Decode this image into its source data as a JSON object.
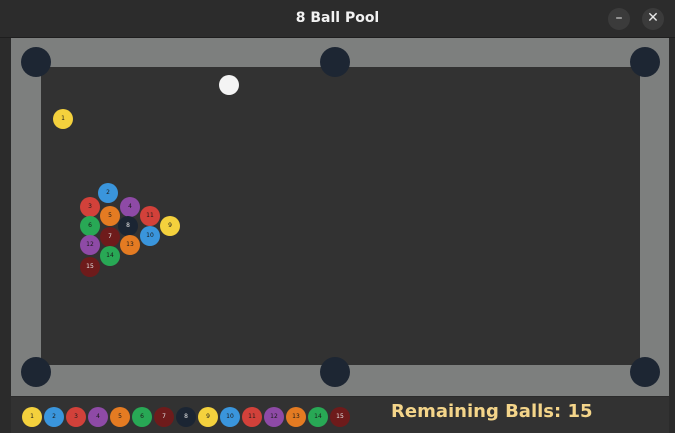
{
  "window": {
    "title": "8 Ball Pool",
    "minimize_label": "–",
    "close_label": "✕"
  },
  "colors": {
    "felt": "#323232",
    "rail": "#7d7f7e",
    "pocket": "#1d2633",
    "cue_ball": "#f4f4f4",
    "score_text": "#f4d58a"
  },
  "table": {
    "balls": [
      {
        "label": "1",
        "color": "#f4d13d"
      },
      {
        "label": "2",
        "color": "#3a95dc"
      },
      {
        "label": "3",
        "color": "#d2413a"
      },
      {
        "label": "4",
        "color": "#8e4aa6"
      },
      {
        "label": "5",
        "color": "#e47b22"
      },
      {
        "label": "6",
        "color": "#28a855"
      },
      {
        "label": "7",
        "color": "#6e1b1b"
      },
      {
        "label": "8",
        "color": "#1b2533"
      },
      {
        "label": "9",
        "color": "#f4d13d"
      },
      {
        "label": "10",
        "color": "#3a95dc"
      },
      {
        "label": "11",
        "color": "#d2413a"
      },
      {
        "label": "12",
        "color": "#8e4aa6"
      },
      {
        "label": "13",
        "color": "#e47b22"
      },
      {
        "label": "14",
        "color": "#28a855"
      },
      {
        "label": "15",
        "color": "#6e1b1b"
      }
    ]
  },
  "tray": {
    "balls": [
      {
        "label": "1",
        "color": "#f4d13d"
      },
      {
        "label": "2",
        "color": "#3a95dc"
      },
      {
        "label": "3",
        "color": "#d2413a"
      },
      {
        "label": "4",
        "color": "#8e4aa6"
      },
      {
        "label": "5",
        "color": "#e47b22"
      },
      {
        "label": "6",
        "color": "#28a855"
      },
      {
        "label": "7",
        "color": "#6e1b1b"
      },
      {
        "label": "8",
        "color": "#1b2533"
      },
      {
        "label": "9",
        "color": "#f4d13d"
      },
      {
        "label": "10",
        "color": "#3a95dc"
      },
      {
        "label": "11",
        "color": "#d2413a"
      },
      {
        "label": "12",
        "color": "#8e4aa6"
      },
      {
        "label": "13",
        "color": "#e47b22"
      },
      {
        "label": "14",
        "color": "#28a855"
      },
      {
        "label": "15",
        "color": "#6e1b1b"
      }
    ],
    "remaining_text": "Remaining Balls: 15"
  }
}
